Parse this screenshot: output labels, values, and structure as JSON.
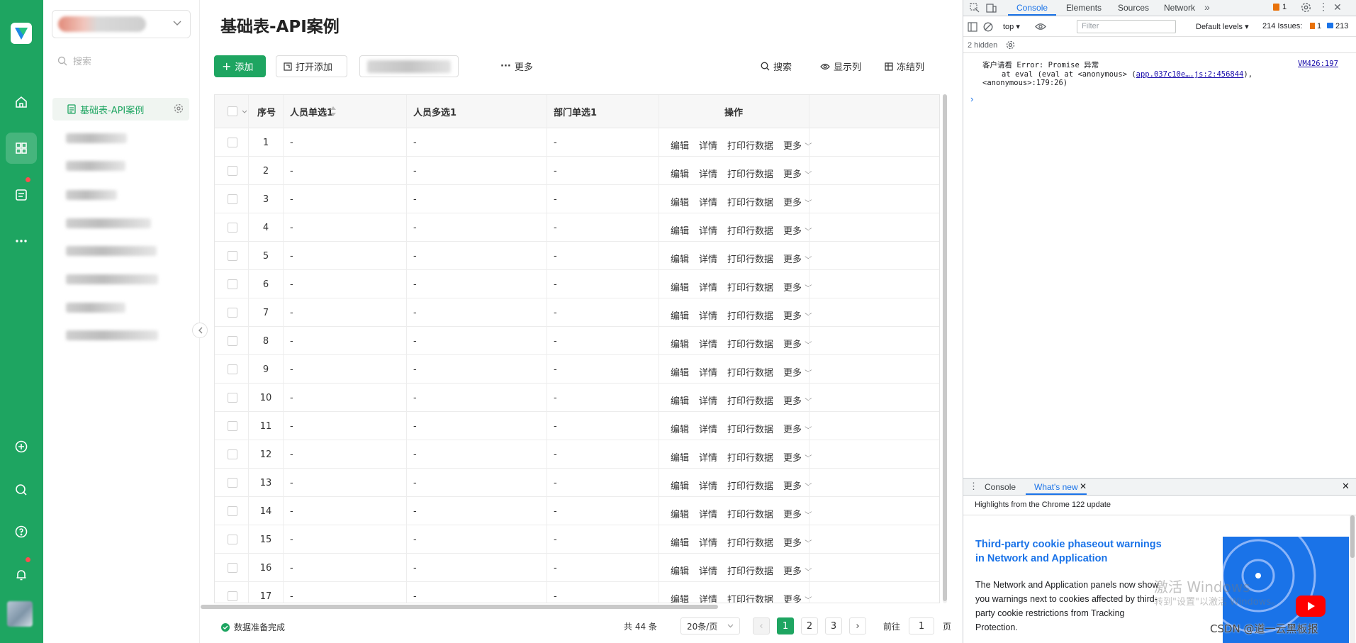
{
  "page_title": "基础表-API案例",
  "sidebar": {
    "search_placeholder": "搜索",
    "active_item": "基础表-API案例"
  },
  "toolbar": {
    "add_label": "添加",
    "open_add_label": "打开添加",
    "more_label": "更多",
    "search_label": "搜索",
    "display_columns_label": "显示列",
    "freeze_columns_label": "冻结列"
  },
  "table": {
    "columns": [
      "序号",
      "人员单选1",
      "人员多选1",
      "部门单选1",
      "操作"
    ],
    "rows": [
      {
        "index": "1",
        "c1": "-",
        "c2": "-",
        "c3": "-"
      },
      {
        "index": "2",
        "c1": "-",
        "c2": "-",
        "c3": "-"
      },
      {
        "index": "3",
        "c1": "-",
        "c2": "-",
        "c3": "-"
      },
      {
        "index": "4",
        "c1": "-",
        "c2": "-",
        "c3": "-"
      },
      {
        "index": "5",
        "c1": "-",
        "c2": "-",
        "c3": "-"
      },
      {
        "index": "6",
        "c1": "-",
        "c2": "-",
        "c3": "-"
      },
      {
        "index": "7",
        "c1": "-",
        "c2": "-",
        "c3": "-"
      },
      {
        "index": "8",
        "c1": "-",
        "c2": "-",
        "c3": "-"
      },
      {
        "index": "9",
        "c1": "-",
        "c2": "-",
        "c3": "-"
      },
      {
        "index": "10",
        "c1": "-",
        "c2": "-",
        "c3": "-"
      },
      {
        "index": "11",
        "c1": "-",
        "c2": "-",
        "c3": "-"
      },
      {
        "index": "12",
        "c1": "-",
        "c2": "-",
        "c3": "-"
      },
      {
        "index": "13",
        "c1": "-",
        "c2": "-",
        "c3": "-"
      },
      {
        "index": "14",
        "c1": "-",
        "c2": "-",
        "c3": "-"
      },
      {
        "index": "15",
        "c1": "-",
        "c2": "-",
        "c3": "-"
      },
      {
        "index": "16",
        "c1": "-",
        "c2": "-",
        "c3": "-"
      },
      {
        "index": "17",
        "c1": "-",
        "c2": "-",
        "c3": "-"
      }
    ],
    "actions": {
      "edit": "编辑",
      "detail": "详情",
      "print": "打印行数据",
      "more": "更多"
    }
  },
  "footer": {
    "status": "数据准备完成",
    "total": "共 44 条",
    "page_size": "20条/页",
    "pages": [
      "1",
      "2",
      "3"
    ],
    "goto_prefix": "前往",
    "goto_value": "1",
    "goto_suffix": "页"
  },
  "devtools": {
    "tabs": [
      "Console",
      "Elements",
      "Sources",
      "Network"
    ],
    "issues_badge": "1",
    "context": "top",
    "filter_placeholder": "Filter",
    "levels": "Default levels",
    "issues_text": "214 Issues:",
    "issues_warn": "1",
    "issues_info": "213",
    "hidden": "2 hidden",
    "message_line1": "客户请看 Error: Promise 异常",
    "message_line2a": "at eval (eval at <anonymous> (",
    "message_link": "app.037c10e….js:2:456844",
    "message_line2b": "),",
    "message_line3": "<anonymous>:179:26)",
    "message_source": "VM426:197",
    "drawer_tabs": [
      "Console",
      "What's new"
    ],
    "whats_new_header": "Highlights from the Chrome 122 update",
    "whats_new_title": "Third-party cookie phaseout warnings in Network and Application",
    "whats_new_body": "The Network and Application panels now show you warnings next to cookies affected by third-party cookie restrictions from Tracking Protection."
  },
  "overlay": {
    "activate_windows": "激活 Windows",
    "activate_windows_sub": "转到\"设置\"以激活 Windows。",
    "csdn": "CSDN @道一云黑板报"
  },
  "colors": {
    "brand_green": "#1ea561",
    "devtools_blue": "#1a73e8"
  }
}
